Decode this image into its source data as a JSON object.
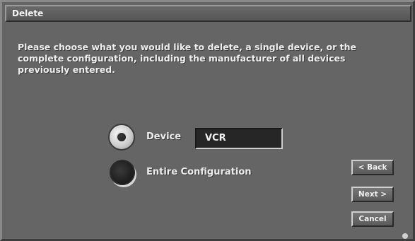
{
  "window": {
    "title": "Delete"
  },
  "instructions": "Please choose what you would like to delete, a single device, or the complete configuration, including the manufacturer of all devices previously entered.",
  "options": {
    "device": {
      "label": "Device",
      "selected": true,
      "field_value": "VCR"
    },
    "entire": {
      "label": "Entire Configuration",
      "selected": false
    }
  },
  "buttons": {
    "back": "< Back",
    "next": "Next >",
    "cancel": "Cancel"
  },
  "colors": {
    "background": "#656565",
    "text": "#eeeeee",
    "field_background": "#262626"
  }
}
